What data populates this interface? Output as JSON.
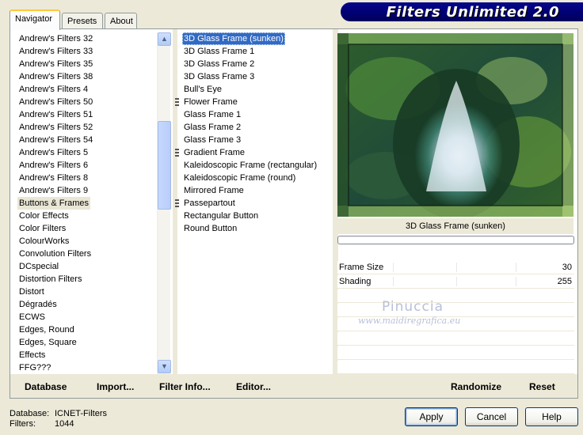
{
  "tabs": [
    {
      "label": "Navigator",
      "active": true
    },
    {
      "label": "Presets",
      "active": false
    },
    {
      "label": "About",
      "active": false
    }
  ],
  "banner": {
    "title": "Filters Unlimited 2.0"
  },
  "categories": {
    "items": [
      "Andrew's Filters 32",
      "Andrew's Filters 33",
      "Andrew's Filters 35",
      "Andrew's Filters 38",
      "Andrew's Filters 4",
      "Andrew's Filters 50",
      "Andrew's Filters 51",
      "Andrew's Filters 52",
      "Andrew's Filters 54",
      "Andrew's Filters 5",
      "Andrew's Filters 6",
      "Andrew's Filters 8",
      "Andrew's Filters 9",
      "Buttons & Frames",
      "Color Effects",
      "Color Filters",
      "ColourWorks",
      "Convolution Filters",
      "DCspecial",
      "Distortion Filters",
      "Distort",
      "Dégradés",
      "ECWS",
      "Edges, Round",
      "Edges, Square",
      "Effects",
      "FFG???"
    ],
    "selected": "Buttons & Frames"
  },
  "filters": {
    "items": [
      {
        "label": "3D Glass Frame (sunken)",
        "group": false
      },
      {
        "label": "3D Glass Frame 1",
        "group": false
      },
      {
        "label": "3D Glass Frame 2",
        "group": false
      },
      {
        "label": "3D Glass Frame 3",
        "group": false
      },
      {
        "label": "Bull's Eye",
        "group": false
      },
      {
        "label": "Flower Frame",
        "group": true
      },
      {
        "label": "Glass Frame 1",
        "group": false
      },
      {
        "label": "Glass Frame 2",
        "group": false
      },
      {
        "label": "Glass Frame 3",
        "group": false
      },
      {
        "label": "Gradient Frame",
        "group": true
      },
      {
        "label": "Kaleidoscopic Frame (rectangular)",
        "group": false
      },
      {
        "label": "Kaleidoscopic Frame (round)",
        "group": false
      },
      {
        "label": "Mirrored Frame",
        "group": false
      },
      {
        "label": "Passepartout",
        "group": true
      },
      {
        "label": "Rectangular Button",
        "group": false
      },
      {
        "label": "Round Button",
        "group": false
      }
    ],
    "selected": "3D Glass Frame (sunken)"
  },
  "preview": {
    "label": "3D Glass Frame (sunken)"
  },
  "params": [
    {
      "name": "Frame Size",
      "value": "30"
    },
    {
      "name": "Shading",
      "value": "255"
    }
  ],
  "watermark": {
    "name": "Pinuccia",
    "site": "www.maidiregrafica.eu"
  },
  "toolbar": {
    "database": "Database",
    "import": "Import...",
    "filter_info": "Filter Info...",
    "editor": "Editor...",
    "randomize": "Randomize",
    "reset": "Reset"
  },
  "status": {
    "database_label": "Database:",
    "database_value": "ICNET-Filters",
    "filters_label": "Filters:",
    "filters_value": "1044"
  },
  "buttons": {
    "apply": "Apply",
    "cancel": "Cancel",
    "help": "Help"
  },
  "colors": {
    "banner": "#000070",
    "selection": "#316ac5",
    "tab_highlight": "#ffc83c"
  },
  "icons": {
    "scroll_up": "chevron-up-icon",
    "scroll_down": "chevron-down-icon",
    "group": "grip-icon"
  }
}
